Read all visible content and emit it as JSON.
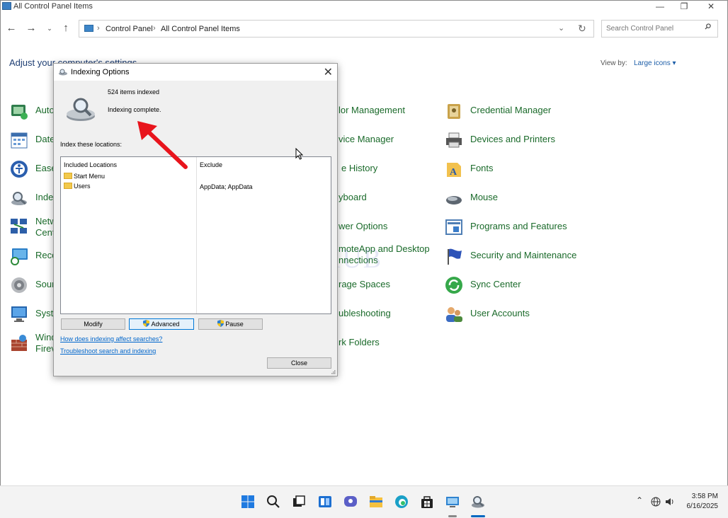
{
  "window": {
    "title": "All Control Panel Items"
  },
  "address": {
    "crumbs": [
      "Control Panel",
      "All Control Panel Items"
    ],
    "search_placeholder": "Search Control Panel"
  },
  "header": {
    "heading": "Adjust your computer's settings",
    "viewby_label": "View by:",
    "viewby_value": "Large icons"
  },
  "items_left": [
    {
      "label": "Auto"
    },
    {
      "label": "Date"
    },
    {
      "label": "Ease"
    },
    {
      "label": "Inde"
    },
    {
      "label": "Netw",
      "label2": "Cent"
    },
    {
      "label": "Reco"
    },
    {
      "label": "Sour"
    },
    {
      "label": "Syst"
    },
    {
      "label": "Wind",
      "label2": "Firev"
    }
  ],
  "items_mid": [
    {
      "label": "lor Management"
    },
    {
      "label": "vice Manager"
    },
    {
      "label": "e History"
    },
    {
      "label": "yboard"
    },
    {
      "label": "wer Options"
    },
    {
      "label": "moteApp and Desktop",
      "label2": "nnections"
    },
    {
      "label": "rage Spaces"
    },
    {
      "label": "ubleshooting"
    },
    {
      "label": "rk Folders"
    }
  ],
  "items_right": [
    {
      "label": "Credential Manager",
      "icon": "credential-manager-icon"
    },
    {
      "label": "Devices and Printers",
      "icon": "printer-icon"
    },
    {
      "label": "Fonts",
      "icon": "fonts-icon"
    },
    {
      "label": "Mouse",
      "icon": "mouse-icon"
    },
    {
      "label": "Programs and Features",
      "icon": "programs-icon"
    },
    {
      "label": "Security and Maintenance",
      "icon": "flag-icon"
    },
    {
      "label": "Sync Center",
      "icon": "sync-icon"
    },
    {
      "label": "User Accounts",
      "icon": "users-icon"
    }
  ],
  "watermark": "IT P   HUB",
  "dialog": {
    "title": "Indexing Options",
    "items_indexed": "524 items indexed",
    "status": "Indexing complete.",
    "index_label": "Index these locations:",
    "col_included": "Included Locations",
    "col_exclude": "Exclude",
    "locations": [
      {
        "name": "Start Menu",
        "exclude": ""
      },
      {
        "name": "Users",
        "exclude": "AppData; AppData"
      }
    ],
    "modify_label": "Modify",
    "advanced_label": "Advanced",
    "pause_label": "Pause",
    "link1": "How does indexing affect searches?",
    "link2": "Troubleshoot search and indexing",
    "close_label": "Close"
  },
  "taskbar": {
    "time": "3:58 PM",
    "date": "6/16/2025"
  },
  "colors": {
    "link_green": "#1a6a2a",
    "heading_blue": "#1e3e73",
    "arrow_red": "#e8141c",
    "accent": "#0078d7"
  }
}
